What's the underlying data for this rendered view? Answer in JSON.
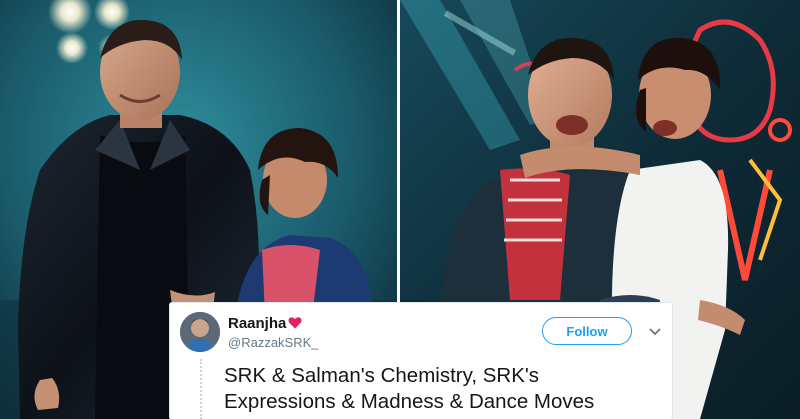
{
  "tweet": {
    "display_name": "Raanjha",
    "handle": "@RazzakSRK_",
    "follow_label": "Follow",
    "text_lines": [
      "SRK & Salman's Chemistry, SRK's",
      "Expressions & Madness & Dance Moves"
    ],
    "heart_color": "#e0245e",
    "accent_color": "#1da1f2"
  },
  "icons": {
    "verified_heart": "heart-icon",
    "caret": "chevron-down-icon"
  }
}
